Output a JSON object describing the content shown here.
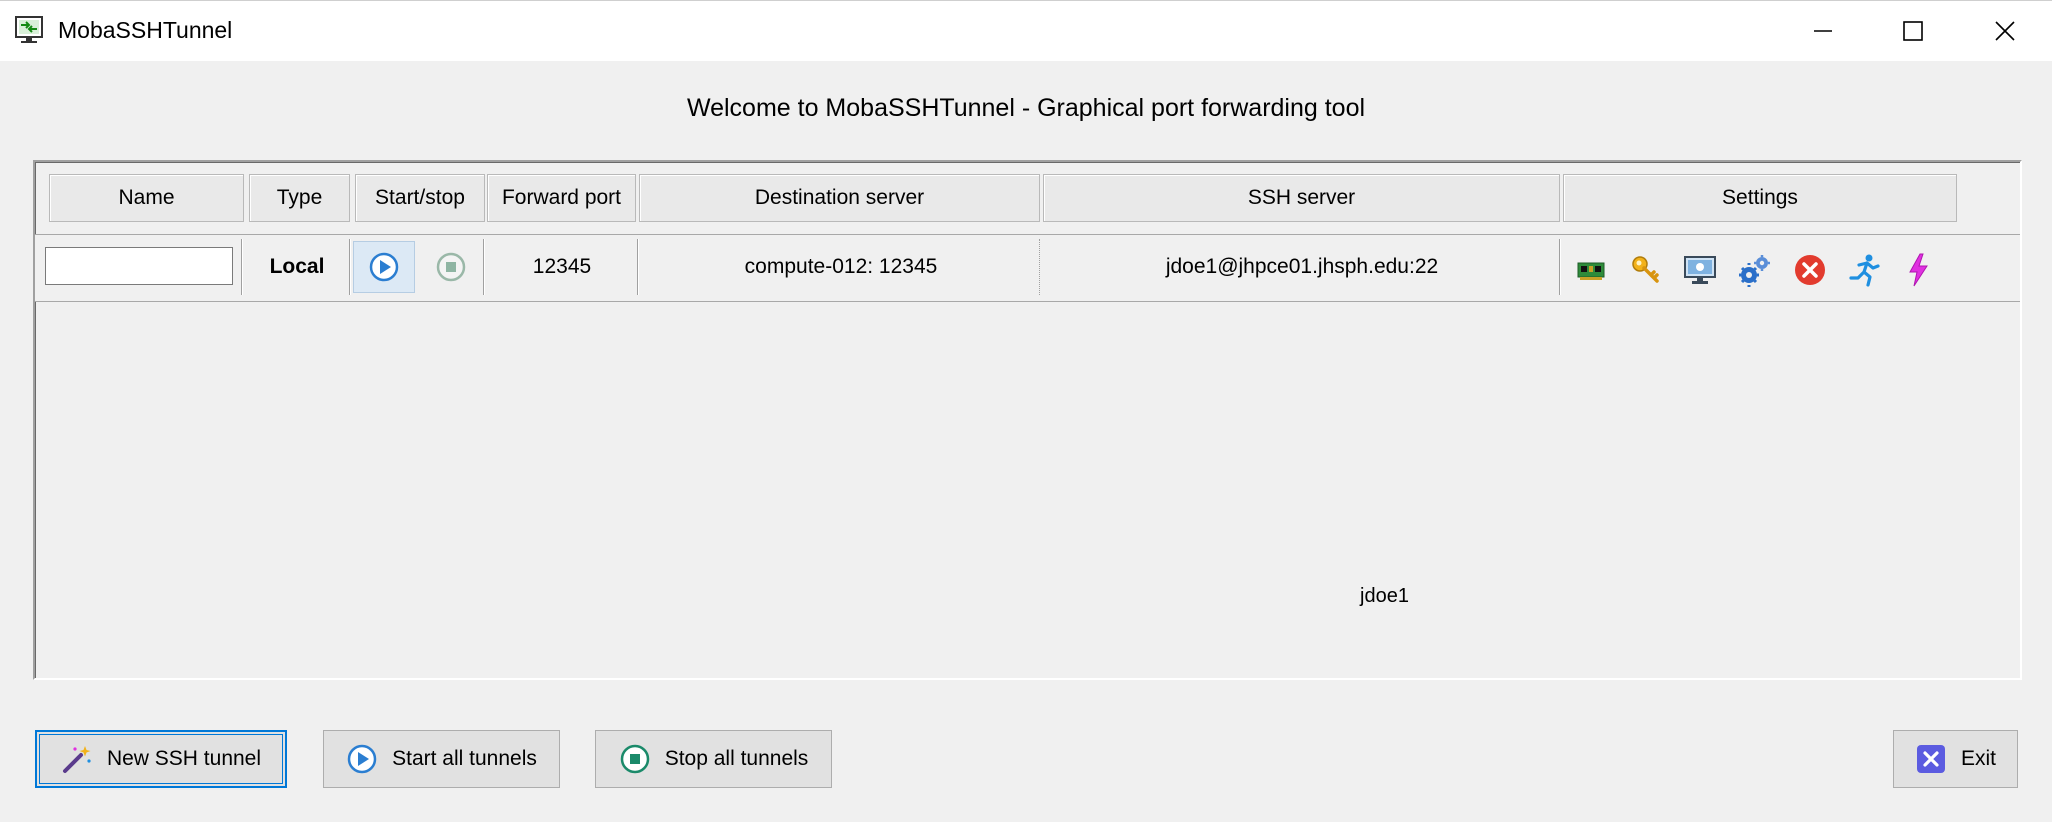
{
  "window": {
    "title": "MobaSSHTunnel",
    "controls": [
      "minimize-icon",
      "maximize-icon",
      "close-icon"
    ]
  },
  "welcome_text": "Welcome to MobaSSHTunnel - Graphical port forwarding tool",
  "table": {
    "headers": [
      "Name",
      "Type",
      "Start/stop",
      "Forward port",
      "Destination server",
      "SSH server",
      "Settings"
    ],
    "rows": [
      {
        "name": "",
        "type": "Local",
        "forward_port": "12345",
        "destination": "compute-012: 12345",
        "ssh_server": "jdoe1@jhpce01.jhsph.edu:22",
        "settings_icons": [
          "network-card-icon",
          "key-icon",
          "monitor-icon",
          "gears-icon",
          "delete-icon",
          "autostart-runner-icon",
          "lightning-icon"
        ]
      }
    ],
    "floating_text": "jdoe1"
  },
  "buttons": {
    "new_tunnel": "New SSH tunnel",
    "start_all": "Start all tunnels",
    "stop_all": "Stop all tunnels",
    "exit": "Exit"
  },
  "colors": {
    "accent": "#0078d7",
    "start_icon": "#2b7ed1",
    "stop_icon": "#1b9e77",
    "delete_icon": "#e23b2e",
    "lightning_icon": "#e030e0"
  }
}
